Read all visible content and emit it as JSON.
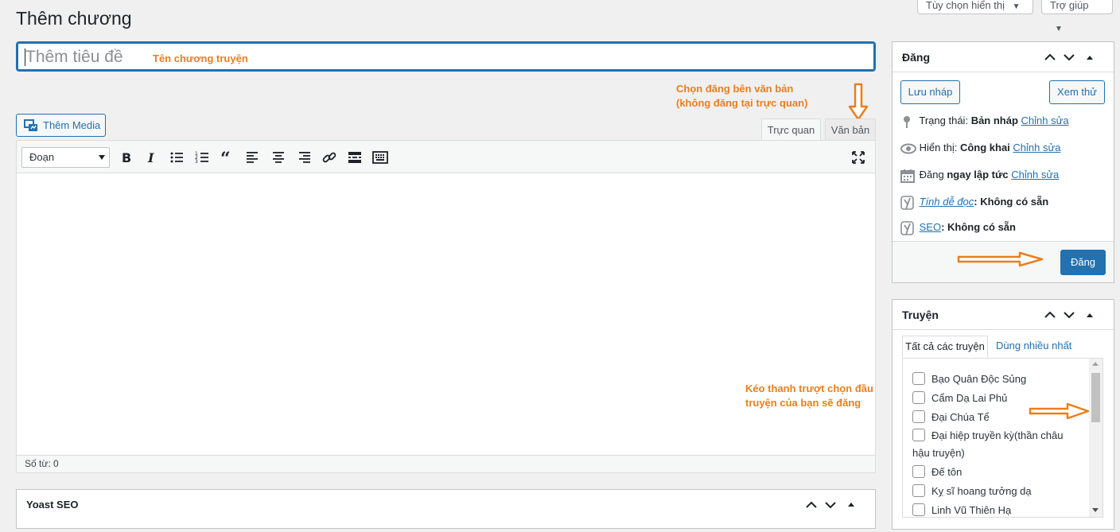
{
  "header": {
    "screen_options": "Tùy chọn hiển thị",
    "help": "Trợ giúp",
    "page_title": "Thêm chương"
  },
  "title_field": {
    "placeholder": "Thêm tiêu đề",
    "annotation": "Tên chương truyện"
  },
  "annotations": {
    "tab_note_line1": "Chọn đăng bên văn bản",
    "tab_note_line2": "(không đăng tại trực quan)",
    "scroll_note_line1": "Kéo thanh trượt chọn đầu",
    "scroll_note_line2": "truyện của bạn sẽ đăng",
    "color": "#e97f1e"
  },
  "editor": {
    "add_media": "Thêm Media",
    "tab_visual": "Trực quan",
    "tab_text": "Văn bản",
    "format_select": "Đoạn",
    "word_count": "Số từ: 0"
  },
  "yoast": {
    "title": "Yoast SEO"
  },
  "publish": {
    "title": "Đăng",
    "save_draft": "Lưu nháp",
    "preview": "Xem thử",
    "status_label": "Trạng thái:",
    "status_value": "Bản nháp",
    "visibility_label": "Hiển thị:",
    "visibility_value": "Công khai",
    "schedule_label": "Đăng",
    "schedule_value": "ngay lập tức",
    "readability_label": "Tính dễ đọc",
    "readability_value": ": Không có sẵn",
    "seo_label": "SEO",
    "seo_value": ": Không có sẵn",
    "edit_link": "Chỉnh sửa",
    "publish_button": "Đăng",
    "accent": "#2271b1"
  },
  "stories": {
    "title": "Truyện",
    "tab_all": "Tất cả các truyện",
    "tab_most_used": "Dùng nhiều nhất",
    "items": [
      "Bạo Quân Độc Sủng",
      "Cẩm Dạ Lai Phủ",
      "Đại Chúa Tể",
      "Đại hiệp truyền kỳ(thần châu",
      "hậu truyện)",
      "Đế tôn",
      "Kỵ sĩ hoang tưởng dạ",
      "Linh Vũ Thiên Hạ"
    ]
  }
}
